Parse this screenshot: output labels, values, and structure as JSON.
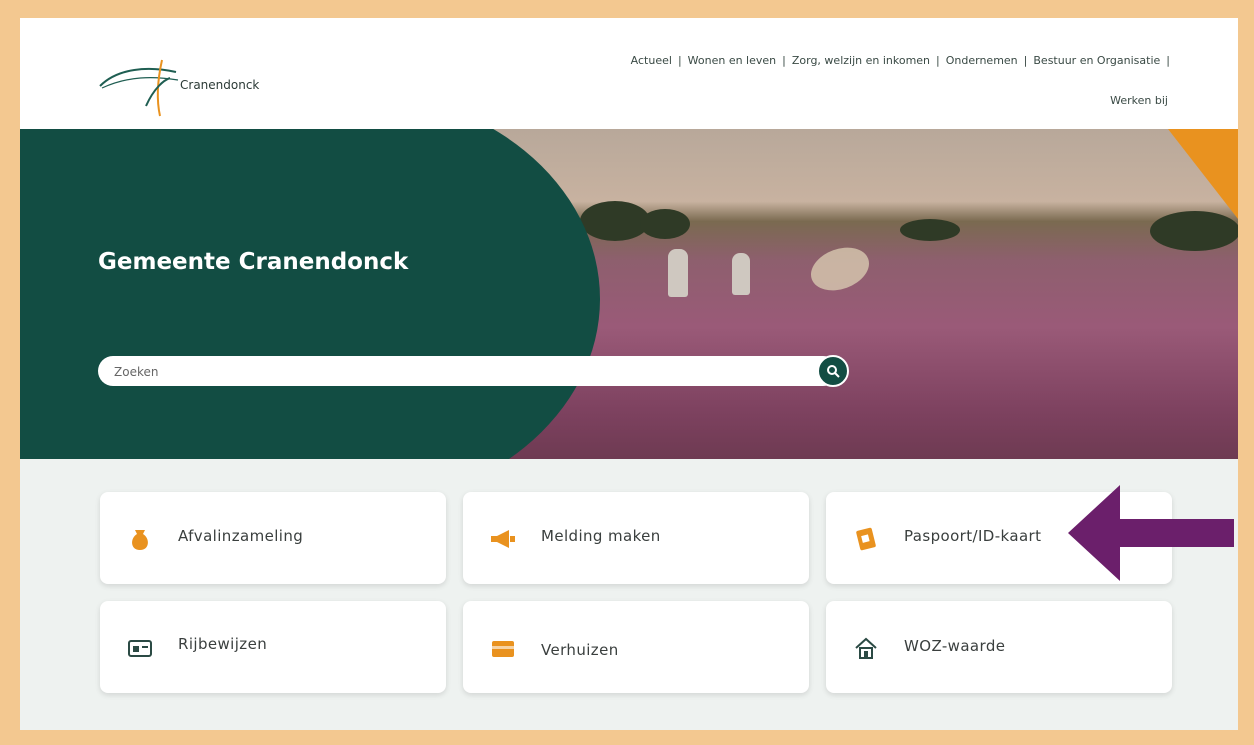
{
  "site": {
    "logo_text": "Cranendonck",
    "nav": {
      "items": [
        "Actueel",
        "Wonen en leven",
        "Zorg, welzijn en inkomen",
        "Ondernemen",
        "Bestuur en Organisatie"
      ],
      "second_row": "Werken bij"
    }
  },
  "hero": {
    "title": "Gemeente Cranendonck",
    "search": {
      "placeholder": "Zoeken"
    }
  },
  "tiles": [
    {
      "label": "Afvalinzameling",
      "icon": "waste-bag-icon"
    },
    {
      "label": "Melding maken",
      "icon": "megaphone-icon"
    },
    {
      "label": "Paspoort/ID-kaart",
      "icon": "passport-icon"
    },
    {
      "label": "Rijbewijzen",
      "icon": "drivers-license-icon"
    },
    {
      "label": "Verhuizen",
      "icon": "moving-box-icon"
    },
    {
      "label": "WOZ-waarde",
      "icon": "house-icon"
    }
  ],
  "colors": {
    "brand_green": "#124d43",
    "accent_orange": "#e9921f",
    "frame": "#f3c890",
    "arrow_purple": "#6b1f6b"
  }
}
